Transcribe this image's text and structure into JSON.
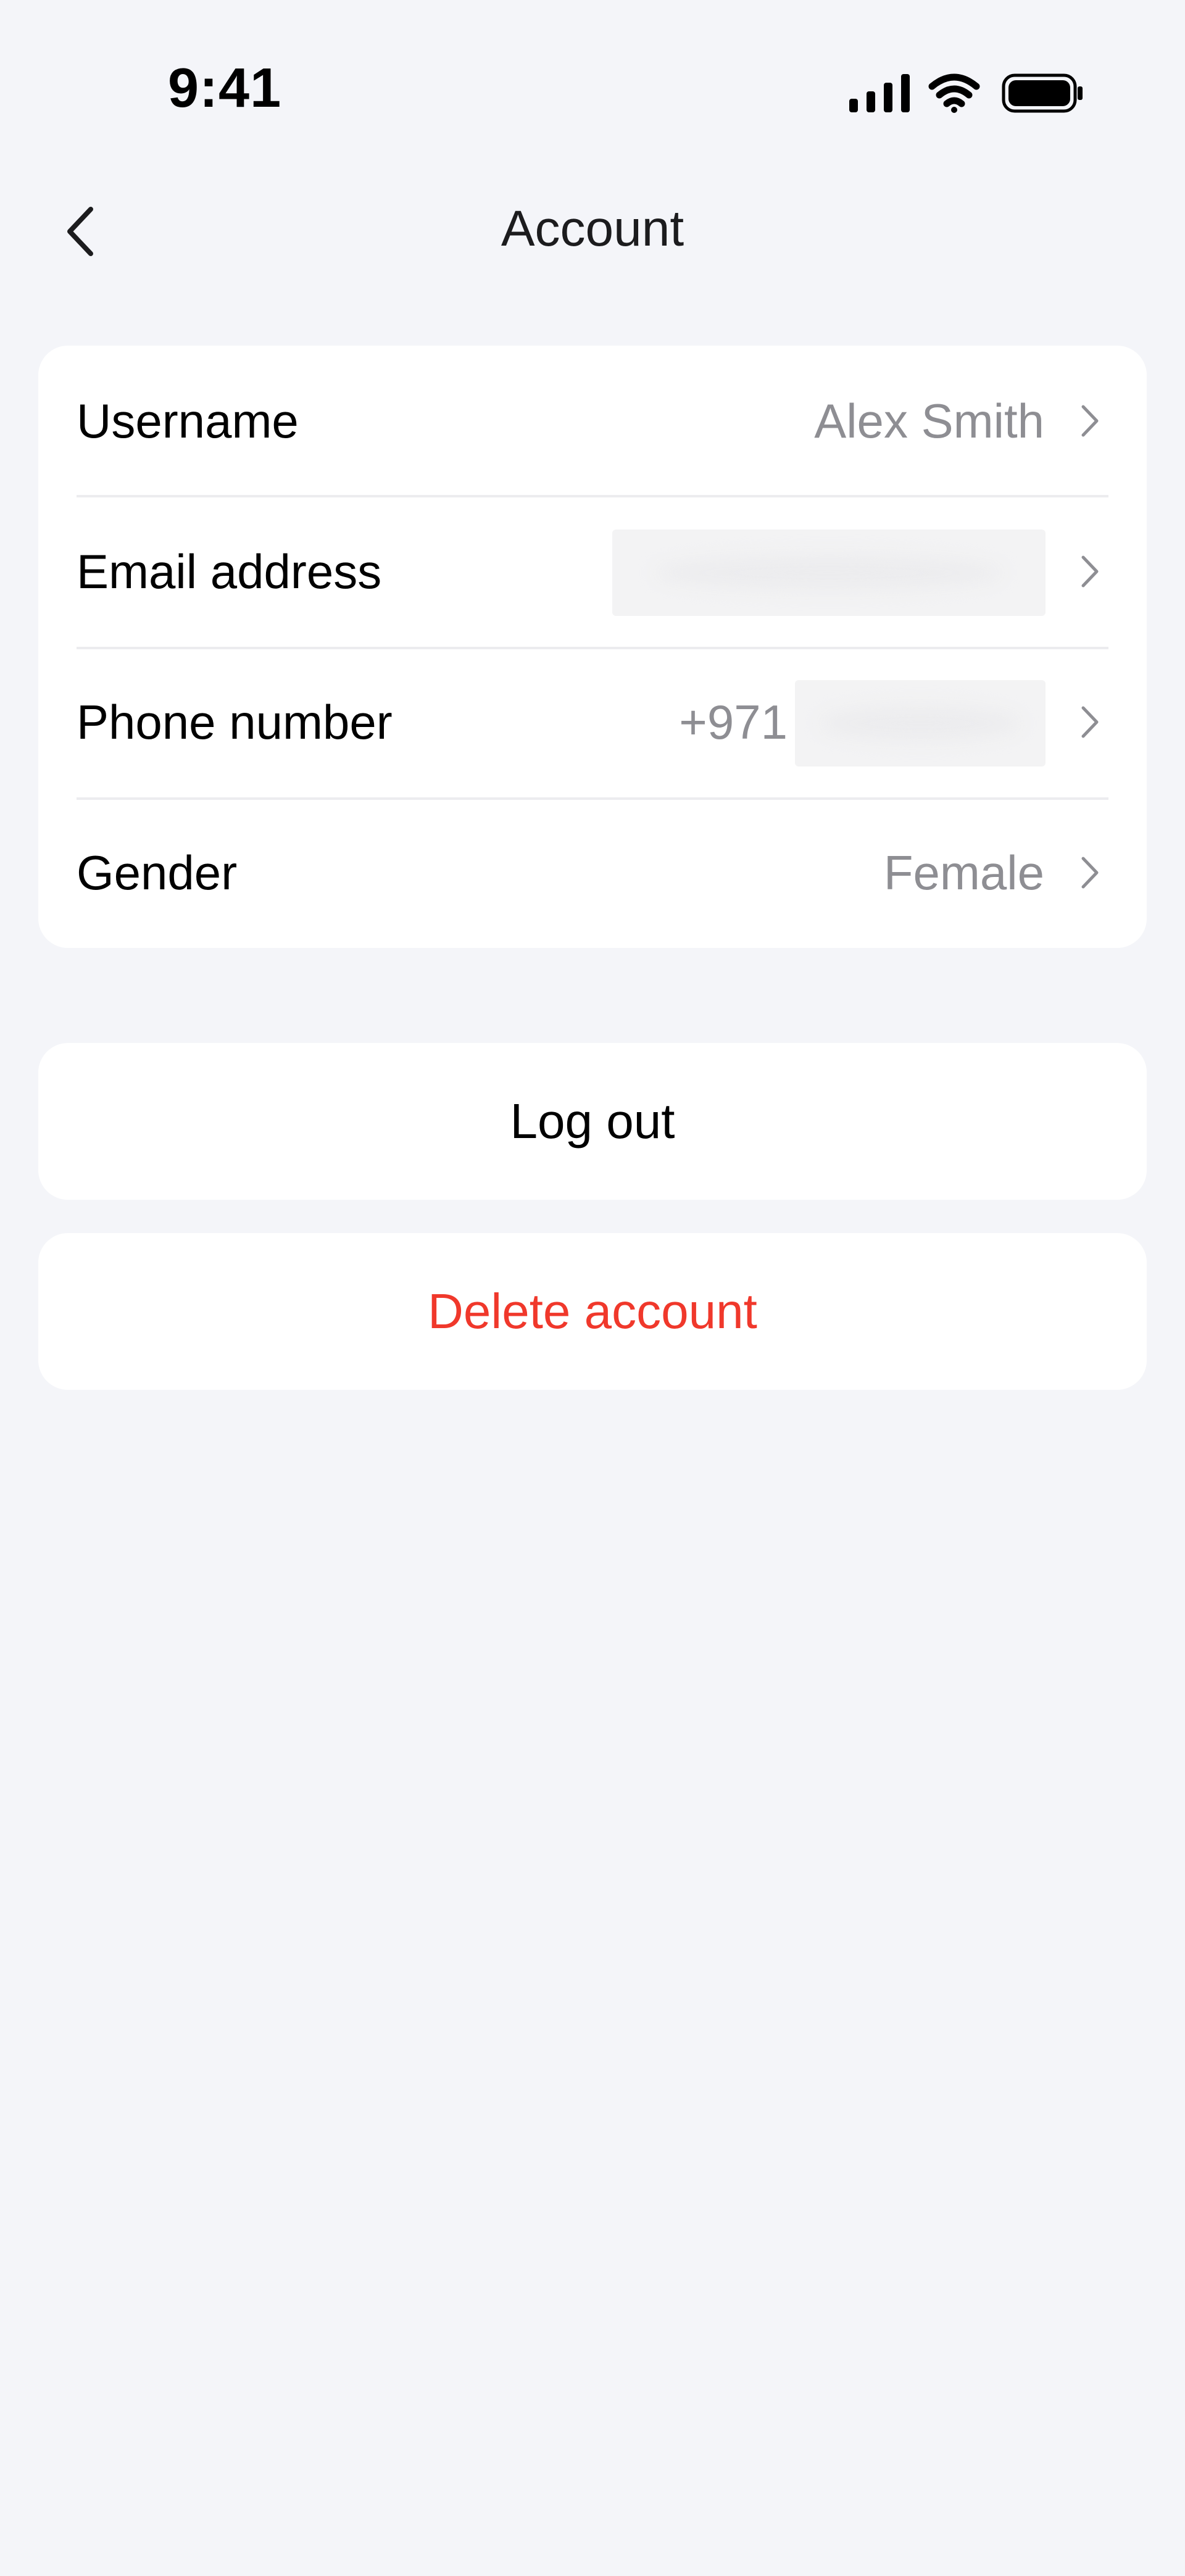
{
  "status_bar": {
    "time": "9:41",
    "icons": [
      "signal-icon",
      "wifi-icon",
      "battery-icon"
    ]
  },
  "nav": {
    "back_icon": "chevron-left-icon",
    "title": "Account"
  },
  "account_fields": [
    {
      "label": "Username",
      "value": "Alex Smith"
    },
    {
      "label": "Email address",
      "value": ""
    },
    {
      "label": "Phone number",
      "value_prefix": "+971"
    },
    {
      "label": "Gender",
      "value": "Female"
    }
  ],
  "actions": {
    "logout_label": "Log out",
    "delete_label": "Delete account"
  },
  "colors": {
    "background": "#f4f5f9",
    "card": "#ffffff",
    "secondary_text": "#8e8e93",
    "destructive": "#f0382b"
  }
}
